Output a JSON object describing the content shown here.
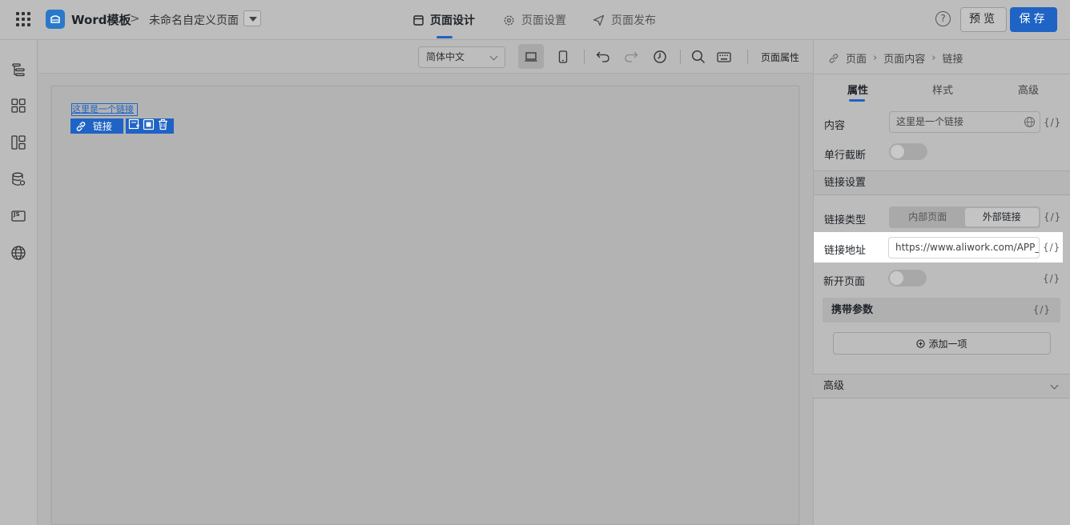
{
  "header": {
    "app_name": "Word模板",
    "breadcrumb_sep": ">",
    "page_name": "未命名自定义页面",
    "tabs": [
      {
        "label": "页面设计",
        "icon": "layout-icon",
        "active": true
      },
      {
        "label": "页面设置",
        "icon": "gear-icon",
        "active": false
      },
      {
        "label": "页面发布",
        "icon": "send-icon",
        "active": false
      }
    ],
    "help_icon": "?",
    "preview_label": "预览",
    "save_label": "保存",
    "accent_color": "#1f63c4"
  },
  "left_sidebar": {
    "icons": [
      "outline-tree-icon",
      "components-icon",
      "layout-blocks-icon",
      "data-source-icon",
      "js-code-icon",
      "globe-icon"
    ],
    "js_label": "JS"
  },
  "toolbar": {
    "language": "简体中文",
    "page_properties": "页面属性",
    "icons": [
      "desktop-icon",
      "mobile-icon",
      "undo-icon",
      "redo-icon",
      "history-icon",
      "search-icon",
      "keyboard-icon"
    ]
  },
  "canvas": {
    "link_text": "这里是一个链接",
    "badge_label": "链接"
  },
  "right_panel": {
    "breadcrumb": [
      "页面",
      "页面内容",
      "链接"
    ],
    "tabs": [
      "属性",
      "样式",
      "高级"
    ],
    "content_label": "内容",
    "content_value": "这里是一个链接",
    "var_label": "{/}",
    "single_line_label": "单行截断",
    "link_settings_title": "链接设置",
    "link_type_label": "链接类型",
    "link_type_options": [
      "内部页面",
      "外部链接"
    ],
    "link_type_selected": "外部链接",
    "link_url_label": "链接地址",
    "link_url_value": "https://www.aliwork.com/APP_",
    "new_tab_label": "新开页面",
    "params_label": "携带参数",
    "add_item_label": "添加一项",
    "advanced_title": "高级"
  }
}
